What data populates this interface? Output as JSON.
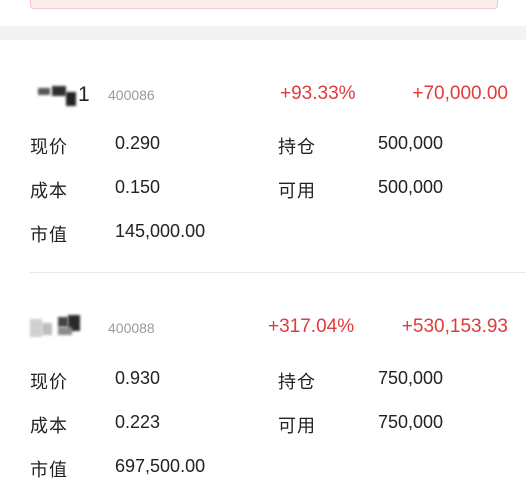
{
  "holdings": [
    {
      "name_suffix": "1",
      "code": "400086",
      "pct_change": "+93.33%",
      "profit": "+70,000.00",
      "price_label": "现价",
      "price": "0.290",
      "position_label": "持仓",
      "position": "500,000",
      "cost_label": "成本",
      "cost": "0.150",
      "available_label": "可用",
      "available": "500,000",
      "market_value_label": "市值",
      "market_value": "145,000.00"
    },
    {
      "code": "400088",
      "pct_change": "+317.04%",
      "profit": "+530,153.93",
      "price_label": "现价",
      "price": "0.930",
      "position_label": "持仓",
      "position": "750,000",
      "cost_label": "成本",
      "cost": "0.223",
      "available_label": "可用",
      "available": "750,000",
      "market_value_label": "市值",
      "market_value": "697,500.00"
    }
  ],
  "colors": {
    "gain": "#e03a3a",
    "muted": "#9a9a9a",
    "text": "#222222"
  }
}
